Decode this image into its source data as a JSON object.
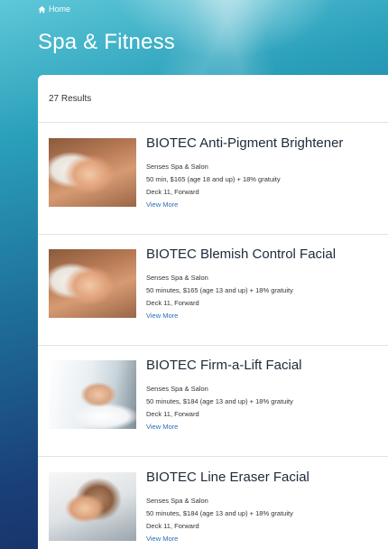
{
  "breadcrumb": {
    "home_label": "Home",
    "icon": "home-icon"
  },
  "page": {
    "title": "Spa & Fitness"
  },
  "results": {
    "count_label": "27 Results"
  },
  "items": [
    {
      "title": "BIOTEC Anti-Pigment Brightener",
      "venue": "Senses Spa & Salon",
      "details": "50 min, $165 (age 18 and up) + 18% gratuity",
      "location": "Deck 11, Forward",
      "link": "View More"
    },
    {
      "title": "BIOTEC Blemish Control Facial",
      "venue": "Senses Spa & Salon",
      "details": "50 minutes, $165 (age 13 and up) + 18% gratuity",
      "location": "Deck 11, Forward",
      "link": "View More"
    },
    {
      "title": "BIOTEC Firm-a-Lift Facial",
      "venue": "Senses Spa & Salon",
      "details": "50 minutes, $184 (age 13 and up) + 18% gratuity",
      "location": "Deck 11, Forward",
      "link": "View More"
    },
    {
      "title": "BIOTEC Line Eraser Facial",
      "venue": "Senses Spa & Salon",
      "details": "50 minutes, $184 (age 13 and up) + 18% gratuity",
      "location": "Deck 11, Forward",
      "link": "View More"
    }
  ]
}
